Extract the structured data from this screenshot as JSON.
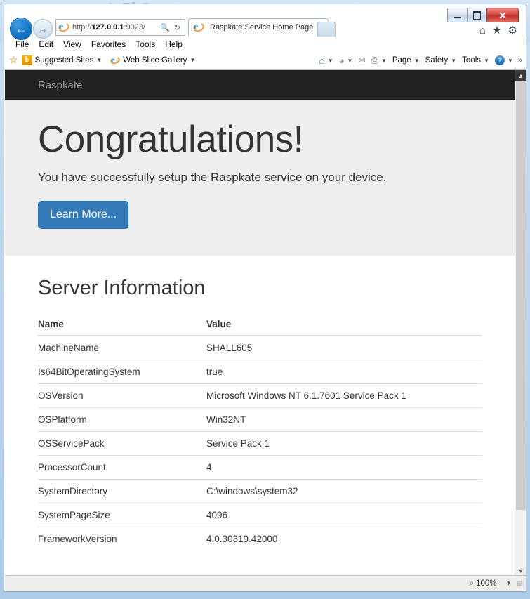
{
  "browser": {
    "window_controls": {
      "minimize": "—",
      "maximize": "❐",
      "close": "✕"
    },
    "navigation": {
      "back": "←",
      "forward": "→"
    },
    "address": {
      "url_scheme": "http://",
      "url_host": "127.0.0.1",
      "url_rest": ":9023/",
      "search_icon": "search-icon",
      "refresh_icon": "refresh-icon"
    },
    "tab": {
      "title": "Raspkate Service Home Page",
      "close": "✕"
    },
    "titlebar_icons": {
      "home": "⌂",
      "favorites": "★",
      "settings": "⚙"
    },
    "menu": [
      "File",
      "Edit",
      "View",
      "Favorites",
      "Tools",
      "Help"
    ],
    "favorites_bar": {
      "star": "☆",
      "items": [
        {
          "label": "Suggested Sites",
          "icon": "bing-icon",
          "caret": "▼"
        },
        {
          "label": "Web Slice Gallery",
          "icon": "ie-icon",
          "caret": "▼"
        }
      ]
    },
    "command_bar": {
      "home_icon": "⌂",
      "feeds_icon": "📶",
      "mail_icon": "✉",
      "print_icon": "🖨",
      "caret": "▼",
      "items": [
        "Page",
        "Safety",
        "Tools"
      ],
      "help_icon": "?",
      "overflow": "»"
    },
    "statusbar": {
      "zoom_level": "100%",
      "zoom_icon": "🔍",
      "caret": "▼"
    }
  },
  "page": {
    "navbar": {
      "brand": "Raspkate"
    },
    "jumbotron": {
      "title": "Congratulations!",
      "lead": "You have successfully setup the Raspkate service on your device.",
      "button_label": "Learn More..."
    },
    "server_info": {
      "heading": "Server Information",
      "columns": [
        "Name",
        "Value"
      ],
      "rows": [
        {
          "name": "MachineName",
          "value": "SHALL605"
        },
        {
          "name": "Is64BitOperatingSystem",
          "value": "true"
        },
        {
          "name": "OSVersion",
          "value": "Microsoft Windows NT 6.1.7601 Service Pack 1"
        },
        {
          "name": "OSPlatform",
          "value": "Win32NT"
        },
        {
          "name": "OSServicePack",
          "value": "Service Pack 1"
        },
        {
          "name": "ProcessorCount",
          "value": "4"
        },
        {
          "name": "SystemDirectory",
          "value": "C:\\windows\\system32"
        },
        {
          "name": "SystemPageSize",
          "value": "4096"
        },
        {
          "name": "FrameworkVersion",
          "value": "4.0.30319.42000"
        }
      ]
    }
  },
  "theme": {
    "navbar_bg": "#222222",
    "jumbotron_bg": "#eeeeee",
    "primary": "#337ab7",
    "text": "#333333"
  }
}
